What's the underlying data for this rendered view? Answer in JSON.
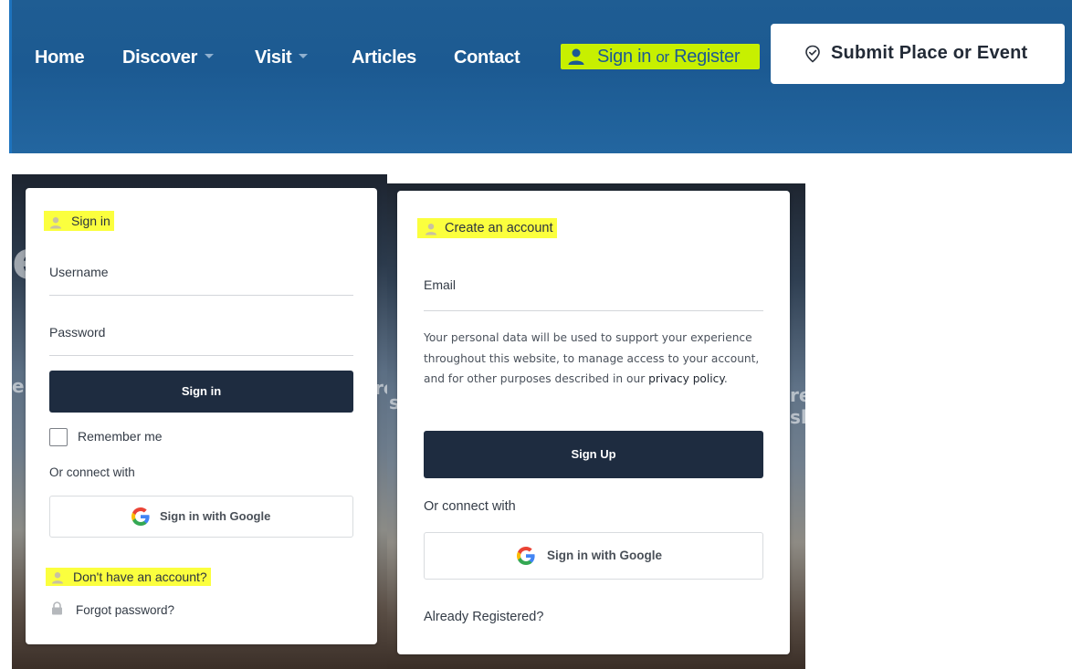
{
  "nav": {
    "items": [
      "Home",
      "Discover",
      "Visit",
      "Articles",
      "Contact"
    ],
    "signin_main": "Sign in",
    "signin_or": "or",
    "signin_register": "Register",
    "submit_label": "Submit Place or Event"
  },
  "signin_card": {
    "title": "Sign in",
    "username_label": "Username",
    "password_label": "Password",
    "button": "Sign in",
    "remember": "Remember me",
    "connect": "Or connect with",
    "google": "Sign in with Google",
    "no_account": "Don't have an account?",
    "forgot": "Forgot password?"
  },
  "register_card": {
    "title": "Create an account",
    "email_label": "Email",
    "legal_text": "Your personal data will be used to support your experience throughout this website, to manage access to your account, and for other purposes described in our",
    "policy_link": "privacy policy",
    "policy_suffix": ".",
    "button": "Sign Up",
    "connect": "Or connect with",
    "google": "Sign in with Google",
    "already": "Already Registered?"
  },
  "background_letters": {
    "l1": "e",
    "l2": "el",
    "l3": "re",
    "l4": "sl",
    "l5": "re",
    "l6": "sl"
  },
  "colors": {
    "nav_bg": "#1c5a92",
    "highlight_green": "#c7f000",
    "highlight_yellow": "#fbff3e",
    "primary_button": "#1e2c40",
    "accent_blue": "#1e73be"
  }
}
